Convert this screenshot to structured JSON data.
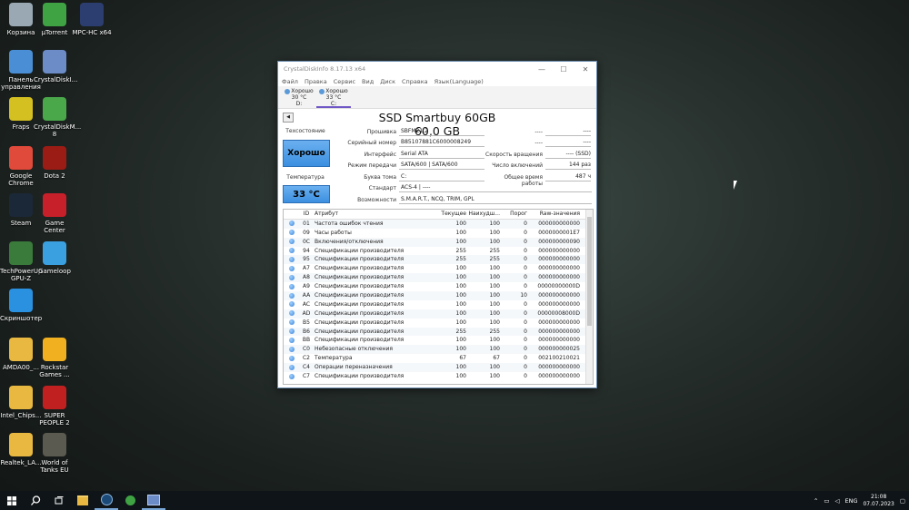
{
  "desktop": {
    "icons": [
      {
        "label": "Корзина",
        "icon": "recycle-bin-icon",
        "color": "#9aa8b4"
      },
      {
        "label": "µTorrent",
        "icon": "utorrent-icon",
        "color": "#3fa344"
      },
      {
        "label": "MPC-HC x64",
        "icon": "mpc-hc-icon",
        "color": "#2c3e70"
      },
      {
        "label": "Панель управления",
        "icon": "control-panel-icon",
        "color": "#4a8fd6"
      },
      {
        "label": "CrystalDiskI...",
        "icon": "crystaldiskinfo-icon",
        "color": "#6c8cc8"
      },
      {
        "label": "Fraps",
        "icon": "fraps-icon",
        "color": "#d4c020"
      },
      {
        "label": "CrystalDiskM... 8",
        "icon": "crystaldiskmark-icon",
        "color": "#4aa84a"
      },
      {
        "label": "Google Chrome",
        "icon": "chrome-icon",
        "color": "#e04a3a"
      },
      {
        "label": "Dota 2",
        "icon": "dota2-icon",
        "color": "#9b1c14"
      },
      {
        "label": "Steam",
        "icon": "steam-icon",
        "color": "#1b2838"
      },
      {
        "label": "Game Center",
        "icon": "game-center-icon",
        "color": "#c8202a"
      },
      {
        "label": "TechPowerUp GPU-Z",
        "icon": "gpuz-icon",
        "color": "#3a7a3a"
      },
      {
        "label": "Gameloop",
        "icon": "gameloop-icon",
        "color": "#3aa0e0"
      },
      {
        "label": "Скриншотер",
        "icon": "screenshot-icon",
        "color": "#2a90e0"
      },
      {
        "label": "AMDA00_...",
        "icon": "folder-icon",
        "color": "#e8b840"
      },
      {
        "label": "Rockstar Games ...",
        "icon": "rockstar-icon",
        "color": "#f0b020"
      },
      {
        "label": "Intel_Chips...",
        "icon": "folder-icon",
        "color": "#e8b840"
      },
      {
        "label": "SUPER PEOPLE 2",
        "icon": "super-people-icon",
        "color": "#c02020"
      },
      {
        "label": "Realtek_LA...",
        "icon": "folder-icon",
        "color": "#e8b840"
      },
      {
        "label": "World of Tanks EU",
        "icon": "wot-icon",
        "color": "#5a5a50"
      }
    ]
  },
  "window": {
    "title": "CrystalDiskInfo 8.17.13 x64",
    "controls": {
      "minimize": "—",
      "maximize": "☐",
      "close": "✕"
    },
    "menu": [
      "Файл",
      "Правка",
      "Сервис",
      "Вид",
      "Диск",
      "Справка",
      "Язык(Language)"
    ],
    "drives": [
      {
        "status": "Хорошо",
        "temp": "30 °C",
        "letter": "D:",
        "active": false
      },
      {
        "status": "Хорошо",
        "temp": "33 °C",
        "letter": "C:",
        "active": true
      }
    ],
    "model": "SSD Smartbuy 60GB 60,0 GB",
    "health_label": "Техсостояние",
    "health_value": "Хорошо",
    "temp_label": "Температура",
    "temp_value": "33 °C",
    "info": {
      "firmware_label": "Прошивка",
      "firmware": "SBFM21.2",
      "serial_label": "Серийный номер",
      "serial": "B85107881C6000008249",
      "interface_label": "Интерфейс",
      "interface": "Serial ATA",
      "transfer_label": "Режим передачи",
      "transfer": "SATA/600 | SATA/600",
      "volume_label": "Буква тома",
      "volume": "C:",
      "standard_label": "Стандарт",
      "standard": "ACS-4 | ----",
      "features_label": "Возможности",
      "features": "S.M.A.R.T., NCQ, TRIM, GPL",
      "right1_label": "----",
      "right1": "----",
      "right2_label": "----",
      "right2": "----",
      "rotation_label": "Скорость вращения",
      "rotation": "---- (SSD)",
      "power_on_count_label": "Число включений",
      "power_on_count": "144 раз",
      "power_on_hours_label": "Общее время работы",
      "power_on_hours": "487 ч"
    },
    "table": {
      "headers": [
        "",
        "ID",
        "Атрибут",
        "Текущее",
        "Наихудш...",
        "Порог",
        "Raw-значения"
      ],
      "rows": [
        {
          "id": "01",
          "name": "Частота ошибок чтения",
          "cur": "100",
          "worst": "100",
          "thr": "0",
          "raw": "000000000000"
        },
        {
          "id": "09",
          "name": "Часы работы",
          "cur": "100",
          "worst": "100",
          "thr": "0",
          "raw": "0000000001E7"
        },
        {
          "id": "0C",
          "name": "Включения/отключения",
          "cur": "100",
          "worst": "100",
          "thr": "0",
          "raw": "000000000090"
        },
        {
          "id": "94",
          "name": "Спецификации производителя",
          "cur": "255",
          "worst": "255",
          "thr": "0",
          "raw": "000000000000"
        },
        {
          "id": "95",
          "name": "Спецификации производителя",
          "cur": "255",
          "worst": "255",
          "thr": "0",
          "raw": "000000000000"
        },
        {
          "id": "A7",
          "name": "Спецификации производителя",
          "cur": "100",
          "worst": "100",
          "thr": "0",
          "raw": "000000000000"
        },
        {
          "id": "A8",
          "name": "Спецификации производителя",
          "cur": "100",
          "worst": "100",
          "thr": "0",
          "raw": "000000000000"
        },
        {
          "id": "A9",
          "name": "Спецификации производителя",
          "cur": "100",
          "worst": "100",
          "thr": "0",
          "raw": "00000000000D"
        },
        {
          "id": "AA",
          "name": "Спецификации производителя",
          "cur": "100",
          "worst": "100",
          "thr": "10",
          "raw": "000000000000"
        },
        {
          "id": "AC",
          "name": "Спецификации производителя",
          "cur": "100",
          "worst": "100",
          "thr": "0",
          "raw": "000000000000"
        },
        {
          "id": "AD",
          "name": "Спецификации производителя",
          "cur": "100",
          "worst": "100",
          "thr": "0",
          "raw": "00000008000D"
        },
        {
          "id": "B5",
          "name": "Спецификации производителя",
          "cur": "100",
          "worst": "100",
          "thr": "0",
          "raw": "000000000000"
        },
        {
          "id": "B6",
          "name": "Спецификации производителя",
          "cur": "255",
          "worst": "255",
          "thr": "0",
          "raw": "000000000000"
        },
        {
          "id": "BB",
          "name": "Спецификации производителя",
          "cur": "100",
          "worst": "100",
          "thr": "0",
          "raw": "000000000000"
        },
        {
          "id": "C0",
          "name": "Небезопасные отключения",
          "cur": "100",
          "worst": "100",
          "thr": "0",
          "raw": "000000000025"
        },
        {
          "id": "C2",
          "name": "Температура",
          "cur": "67",
          "worst": "67",
          "thr": "0",
          "raw": "002100210021"
        },
        {
          "id": "C4",
          "name": "Операции переназначения",
          "cur": "100",
          "worst": "100",
          "thr": "0",
          "raw": "000000000000"
        },
        {
          "id": "C7",
          "name": "Спецификации производителя",
          "cur": "100",
          "worst": "100",
          "thr": "0",
          "raw": "000000000000"
        }
      ]
    }
  },
  "taskbar": {
    "apps": [
      "start-icon",
      "search-icon",
      "task-view-icon",
      "file-explorer-icon",
      "steam-icon",
      "utorrent-icon",
      "crystaldiskinfo-icon"
    ],
    "tray": {
      "language": "ENG",
      "time": "21:08",
      "date": "07.07.2023"
    }
  }
}
